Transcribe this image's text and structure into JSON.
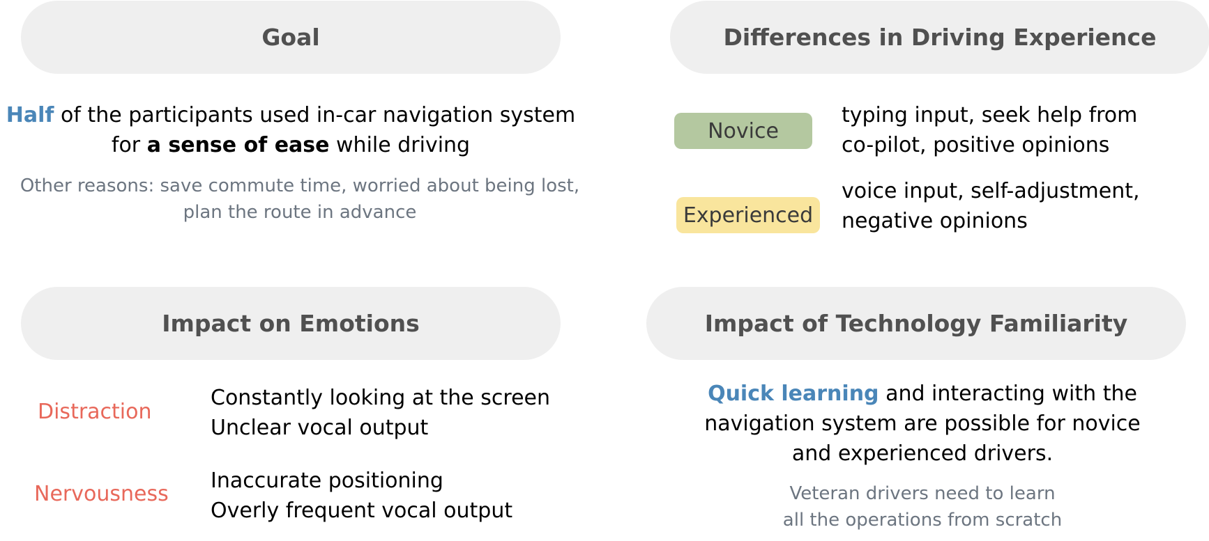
{
  "goal": {
    "title": "Goal",
    "line1_highlight": "Half",
    "line1_rest": " of the participants used in-car navigation system",
    "line2_pre": "for ",
    "line2_bold": "a sense of ease",
    "line2_post": " while driving",
    "other_line1": "Other reasons: save commute time, worried about being lost,",
    "other_line2": "plan the route in advance"
  },
  "experience": {
    "title": "Differences in Driving Experience",
    "novice": {
      "label": "Novice",
      "line1": "typing input, seek help from",
      "line2": "co-pilot, positive opinions"
    },
    "experienced": {
      "label": "Experienced",
      "line1": "voice input, self-adjustment,",
      "line2": "negative opinions"
    }
  },
  "emotions": {
    "title": "Impact on Emotions",
    "distraction": {
      "label": "Distraction",
      "line1": "Constantly looking at the screen",
      "line2": "Unclear vocal output"
    },
    "nervousness": {
      "label": "Nervousness",
      "line1": "Inaccurate positioning",
      "line2": "Overly frequent vocal output"
    }
  },
  "technology": {
    "title": "Impact of Technology Familiarity",
    "line1_highlight": "Quick learning",
    "line1_rest": " and interacting with the",
    "line2": "navigation system are possible for novice",
    "line3": "and experienced drivers.",
    "sub_line1": "Veteran drivers need to learn",
    "sub_line2": "all the operations from scratch"
  },
  "colors": {
    "pill_background": "#efefef",
    "pill_text": "#505050",
    "highlight_blue": "#4a86b8",
    "emotion_red": "#e8685a",
    "novice_tag": "#b4c8a0",
    "experienced_tag": "#f9e59d",
    "secondary_text": "#6c7580"
  }
}
